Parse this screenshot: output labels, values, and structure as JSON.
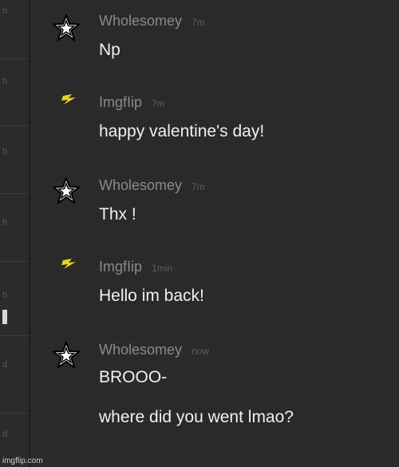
{
  "sidebar": {
    "rows": [
      {
        "letter": "n"
      },
      {
        "letter": "h"
      },
      {
        "letter": "h"
      },
      {
        "letter": "h"
      },
      {
        "letter": "h"
      },
      {
        "letter": "d"
      },
      {
        "letter": "d"
      }
    ]
  },
  "messages": [
    {
      "author": "Wholesomey",
      "time": "7m",
      "avatar": "star-icon",
      "lines": [
        "Np"
      ]
    },
    {
      "author": "ImgfIip",
      "time": "7m",
      "avatar": "lightning-icon",
      "lines": [
        "happy valentine's day!"
      ]
    },
    {
      "author": "Wholesomey",
      "time": "7m",
      "avatar": "star-icon",
      "lines": [
        "Thx !"
      ]
    },
    {
      "author": "ImgfIip",
      "time": "1min",
      "avatar": "lightning-icon",
      "lines": [
        "Hello im back!"
      ]
    },
    {
      "author": "Wholesomey",
      "time": "now",
      "avatar": "star-icon",
      "lines": [
        "BROOO-",
        "where did you went lmao?"
      ]
    }
  ],
  "watermark": "imgflip.com",
  "colors": {
    "background": "#2a2a2a",
    "username": "#8a8a8a",
    "timestamp": "#5e5e5e",
    "message_text": "#f0f0f0",
    "lightning": "#e8d21e"
  }
}
